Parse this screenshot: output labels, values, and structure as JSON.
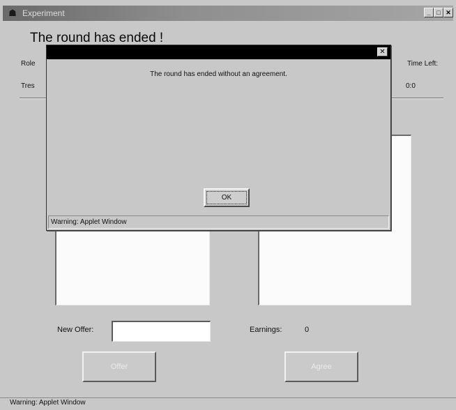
{
  "window": {
    "title": "Experiment",
    "minimize_glyph": "_",
    "maximize_glyph": "□",
    "close_glyph": "✕",
    "icon": "app-icon"
  },
  "main": {
    "headline": "The round has ended !",
    "role_label": "Role",
    "role_value": "Tres",
    "time_left_label": "Time Left:",
    "time_left_value": "0:0",
    "new_offer_label": "New Offer:",
    "new_offer_value": "",
    "earnings_label": "Earnings:",
    "earnings_value": "0",
    "offer_button": "Offer",
    "agree_button": "Agree",
    "status": "Warning: Applet Window"
  },
  "dialog": {
    "title": "",
    "close_glyph": "✕",
    "message": "The round has ended without an agreement.",
    "ok_label": "OK",
    "warning": "Warning: Applet Window"
  }
}
